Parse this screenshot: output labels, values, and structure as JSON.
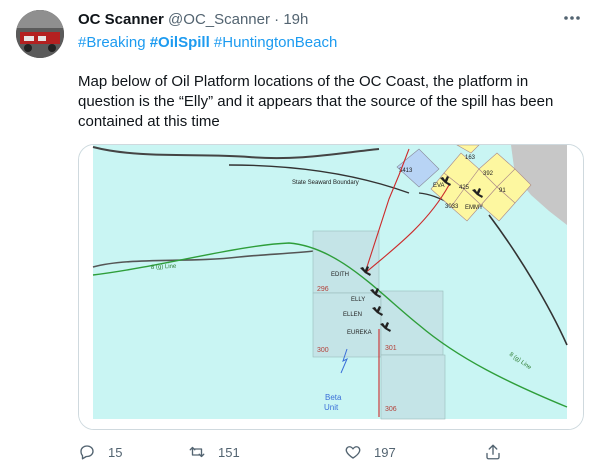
{
  "tweet": {
    "display_name": "OC Scanner",
    "handle": "@OC_Scanner",
    "separator": "·",
    "time": "19h",
    "hashtags": [
      "#Breaking",
      "#OilSpill",
      "#HuntingtonBeach"
    ],
    "text": "Map below of Oil Platform locations of the OC Coast, the platform in question is the “Elly” and it appears that the source of the spill has been contained at this time"
  },
  "map": {
    "boundary_label": "State Seaward Boundary",
    "line_label_left": "8 (g) Line",
    "line_label_right": "8 (g) Line",
    "platforms": [
      "EDITH",
      "ELLY",
      "ELLEN",
      "EUREKA",
      "EVA",
      "EMMY"
    ],
    "blocks": [
      "296",
      "300",
      "301",
      "306",
      "3413",
      "163",
      "392",
      "425",
      "91",
      "3033"
    ],
    "unit_label": [
      "Beta",
      "Unit"
    ]
  },
  "actions": {
    "replies": "15",
    "retweets": "151",
    "likes": "197"
  },
  "colors": {
    "link": "#1d9bf0",
    "muted": "#536471",
    "ocean": "#c9f5f3"
  },
  "icons": [
    "more-icon",
    "reply-icon",
    "retweet-icon",
    "like-icon",
    "share-icon"
  ]
}
